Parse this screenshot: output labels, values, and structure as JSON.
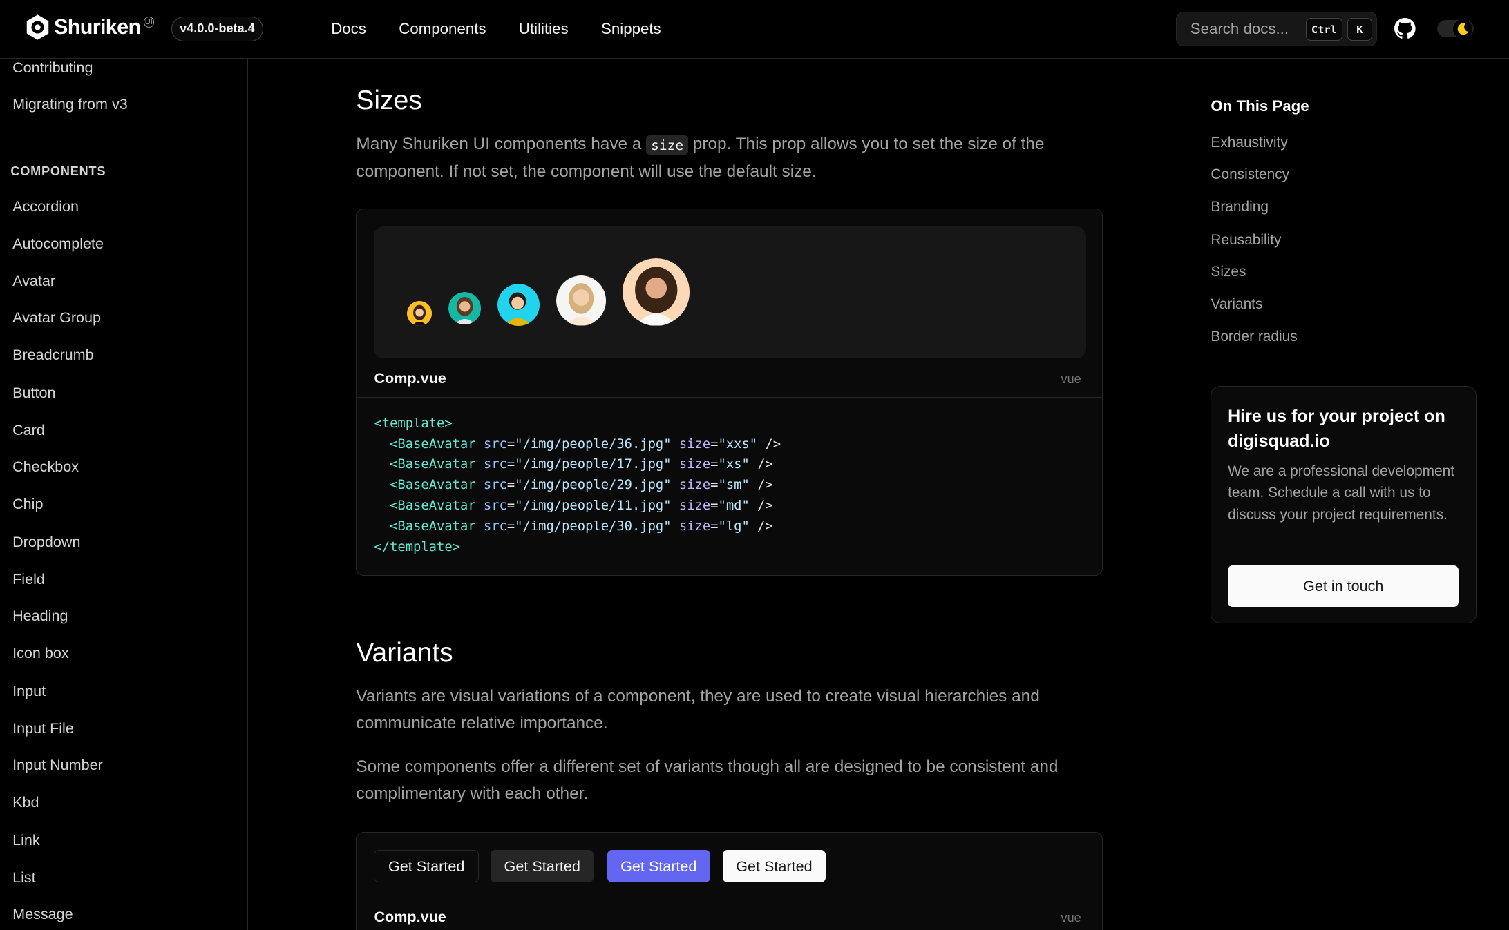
{
  "header": {
    "logo_text": "Shuriken",
    "logo_badge": "UI",
    "version": "v4.0.0-beta.4",
    "nav": [
      "Docs",
      "Components",
      "Utilities",
      "Snippets"
    ],
    "search_placeholder": "Search docs...",
    "kbd_ctrl": "Ctrl",
    "kbd_k": "K"
  },
  "sidebar": {
    "top_items": [
      "Contributing",
      "Migrating from v3"
    ],
    "heading": "COMPONENTS",
    "items": [
      "Accordion",
      "Autocomplete",
      "Avatar",
      "Avatar Group",
      "Breadcrumb",
      "Button",
      "Card",
      "Checkbox",
      "Chip",
      "Dropdown",
      "Field",
      "Heading",
      "Icon box",
      "Input",
      "Input File",
      "Input Number",
      "Kbd",
      "Link",
      "List",
      "Message"
    ]
  },
  "sizes": {
    "title": "Sizes",
    "text_before": "Many Shuriken UI components have a ",
    "code": "size",
    "text_after": " prop. This prop allows you to set the size of the component. If not set, the component will use the default size.",
    "file": "Comp.vue",
    "lang": "vue",
    "code_open": "<template>",
    "code_close": "</template>",
    "avatars": [
      {
        "src": "/img/people/36.jpg",
        "size": "xxs"
      },
      {
        "src": "/img/people/17.jpg",
        "size": "xs"
      },
      {
        "src": "/img/people/29.jpg",
        "size": "sm"
      },
      {
        "src": "/img/people/11.jpg",
        "size": "md"
      },
      {
        "src": "/img/people/30.jpg",
        "size": "lg"
      }
    ]
  },
  "variants": {
    "title": "Variants",
    "p1": "Variants are visual variations of a component, they are used to create visual hierarchies and communicate relative importance.",
    "p2": "Some components offer a different set of variants though all are designed to be consistent and complimentary with each other.",
    "buttons": [
      "Get Started",
      "Get Started",
      "Get Started",
      "Get Started"
    ],
    "file": "Comp.vue",
    "lang": "vue"
  },
  "toc": {
    "title": "On This Page",
    "items": [
      "Exhaustivity",
      "Consistency",
      "Branding",
      "Reusability",
      "Sizes",
      "Variants",
      "Border radius"
    ]
  },
  "hire": {
    "title": "Hire us for your project on digisquad.io",
    "text": "We are a professional development team. Schedule a call with us to discuss your project requirements.",
    "button": "Get in touch"
  },
  "colors": {
    "primary": "#6366f1",
    "background": "#000000",
    "border": "#262626",
    "code_tag": "#5eead4",
    "code_attr": "#93c5fd"
  }
}
